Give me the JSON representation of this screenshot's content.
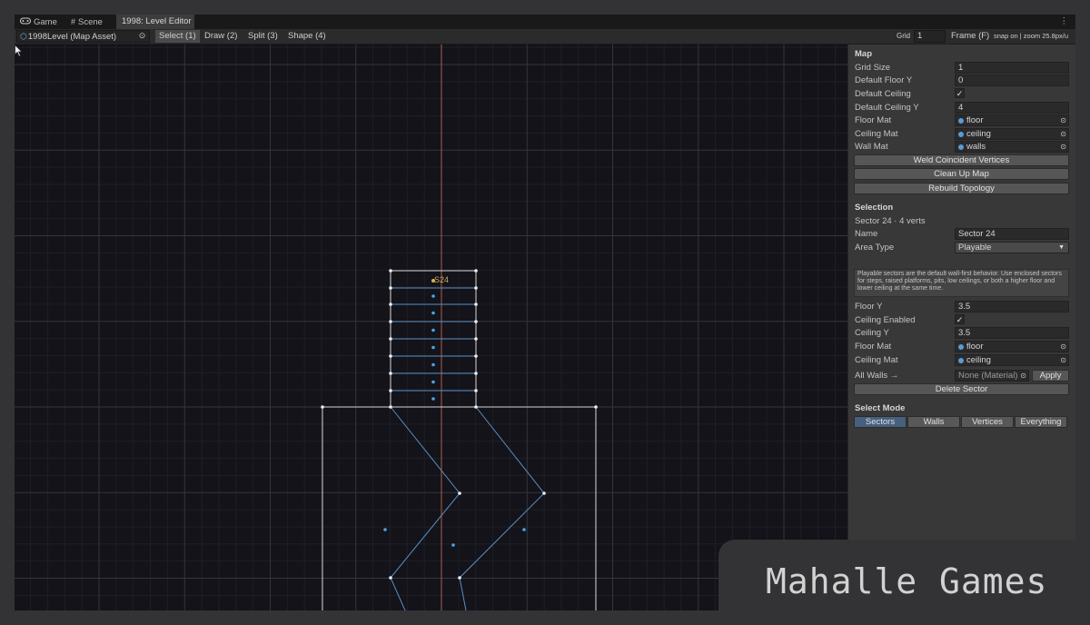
{
  "tabs": [
    {
      "label": "Game",
      "icon": "gamepad-icon"
    },
    {
      "label": "Scene",
      "icon": "grid-icon"
    },
    {
      "label": "1998: Level Editor",
      "icon": ""
    }
  ],
  "tab_menu_glyph": "⋮",
  "toolbar": {
    "asset_field": "1998Level (Map Asset)",
    "modes": [
      "Select (1)",
      "Draw (2)",
      "Split (3)",
      "Shape (4)"
    ],
    "grid_label": "Grid",
    "grid_value": "1",
    "frame_button": "Frame (F)",
    "status": "snap on | zoom 25.8px/u"
  },
  "viewport": {
    "sector_label": "S24",
    "colors": {
      "grid_minor": "#1f1f28",
      "grid_major": "#35353e",
      "axis": "#d2694f",
      "edge_white": "#d6d6d6",
      "edge_blue": "#5a8fc4",
      "centroid": "#4ea3e6",
      "label": "#c9a867"
    }
  },
  "map": {
    "title": "Map",
    "grid_size": {
      "label": "Grid Size",
      "value": "1"
    },
    "default_floor_y": {
      "label": "Default Floor Y",
      "value": "0"
    },
    "default_ceiling": {
      "label": "Default Ceiling",
      "checked": "✓"
    },
    "default_ceiling_y": {
      "label": "Default Ceiling Y",
      "value": "4"
    },
    "floor_mat": {
      "label": "Floor Mat",
      "value": "floor"
    },
    "ceiling_mat": {
      "label": "Ceiling Mat",
      "value": "ceiling"
    },
    "wall_mat": {
      "label": "Wall Mat",
      "value": "walls"
    },
    "buttons": [
      "Weld Coincident Vertices",
      "Clean Up Map",
      "Rebuild Topology"
    ]
  },
  "selection": {
    "title": "Selection",
    "summary": "Sector 24 · 4 verts",
    "name": {
      "label": "Name",
      "value": "Sector 24"
    },
    "area_type": {
      "label": "Area Type",
      "value": "Playable"
    },
    "help": "Playable sectors are the default wall-first behavior. Use enclosed sectors for steps, raised platforms, pits, low ceilings, or both a higher floor and lower ceiling at the same time.",
    "floor_y": {
      "label": "Floor Y",
      "value": "3.5"
    },
    "ceiling_enabled": {
      "label": "Ceiling Enabled",
      "checked": "✓"
    },
    "ceiling_y": {
      "label": "Ceiling Y",
      "value": "3.5"
    },
    "floor_mat": {
      "label": "Floor Mat",
      "value": "floor"
    },
    "ceiling_mat": {
      "label": "Ceiling Mat",
      "value": "ceiling"
    },
    "all_walls": {
      "label": "All Walls →",
      "value": "None (Material)",
      "apply": "Apply"
    },
    "delete_button": "Delete Sector"
  },
  "select_mode": {
    "title": "Select Mode",
    "options": [
      "Sectors",
      "Walls",
      "Vertices",
      "Everything"
    ],
    "active": "Sectors"
  },
  "watermark": "Mahalle Games"
}
